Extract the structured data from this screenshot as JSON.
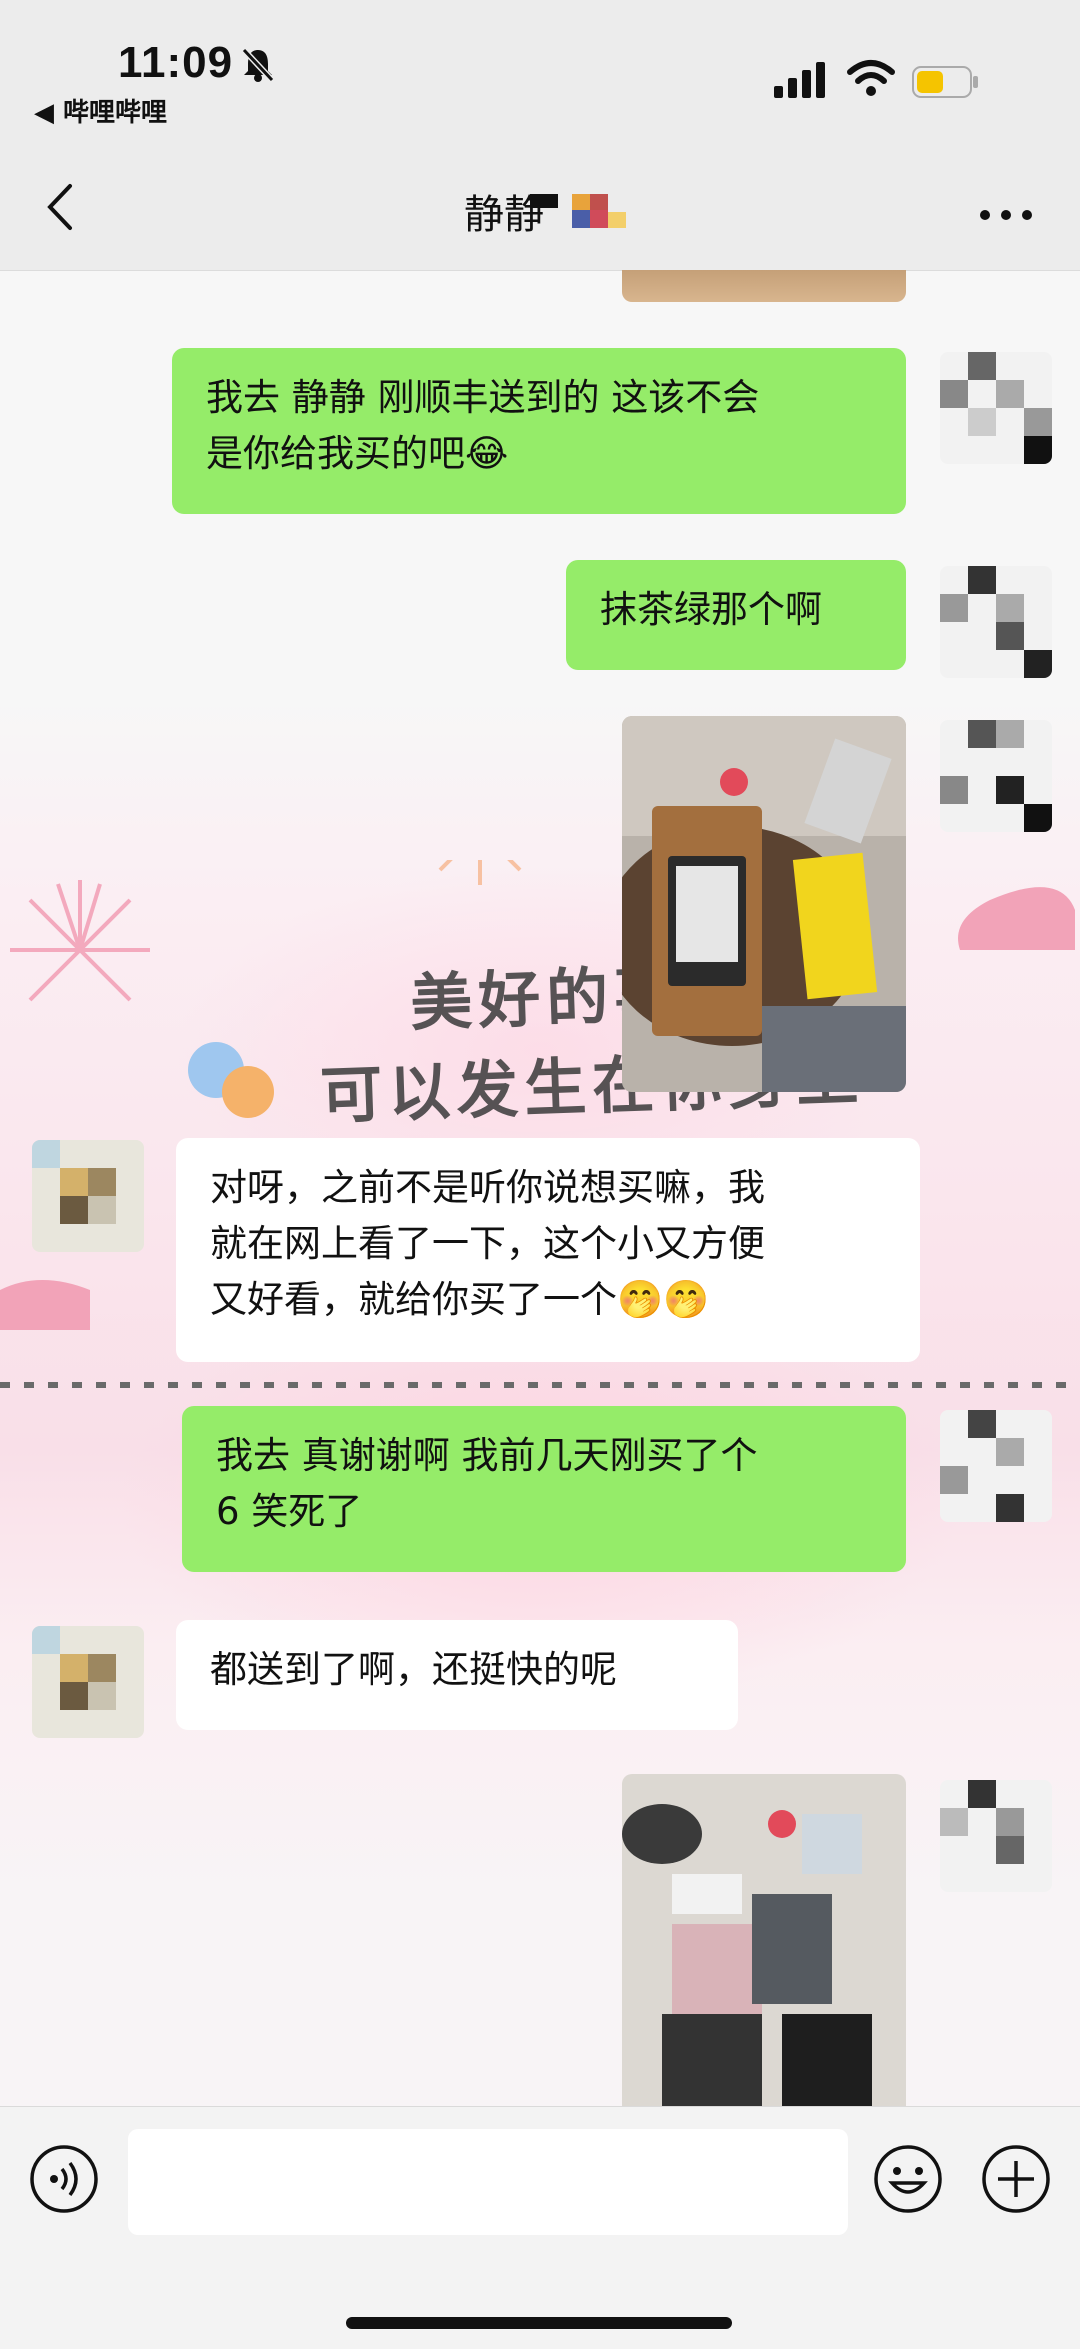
{
  "status_bar": {
    "time": "11:09",
    "back_app": "◀ 哔哩哔哩"
  },
  "nav": {
    "title": "静静"
  },
  "wallpaper": {
    "text_line1": "美好的事",
    "text_line2": "可以发生在你身上"
  },
  "messages": [
    {
      "side": "me",
      "type": "image",
      "alt": "package top"
    },
    {
      "side": "me",
      "type": "text",
      "line1": "我去 静静 刚顺丰送到的 这该不会",
      "line2": "是你给我买的吧😂"
    },
    {
      "side": "me",
      "type": "text",
      "line1": "抹茶绿那个啊"
    },
    {
      "side": "me",
      "type": "image",
      "alt": "kindle package photo"
    },
    {
      "side": "them",
      "type": "text",
      "line1": "对呀，之前不是听你说想买嘛，我",
      "line2": "就在网上看了一下，这个小又方便",
      "line3": "又好看，就给你买了一个🤭🤭"
    },
    {
      "side": "me",
      "type": "text",
      "line1": "我去 真谢谢啊 我前几天刚买了个",
      "line2": "6 笑死了"
    },
    {
      "side": "them",
      "type": "text",
      "line1": "都送到了啊，还挺快的呢"
    },
    {
      "side": "me",
      "type": "image",
      "alt": "unboxed items photo"
    }
  ],
  "colors": {
    "my_bubble": "#95ec69",
    "their_bubble": "#ffffff",
    "nav_bg": "#ececec"
  },
  "input": {
    "placeholder": ""
  }
}
